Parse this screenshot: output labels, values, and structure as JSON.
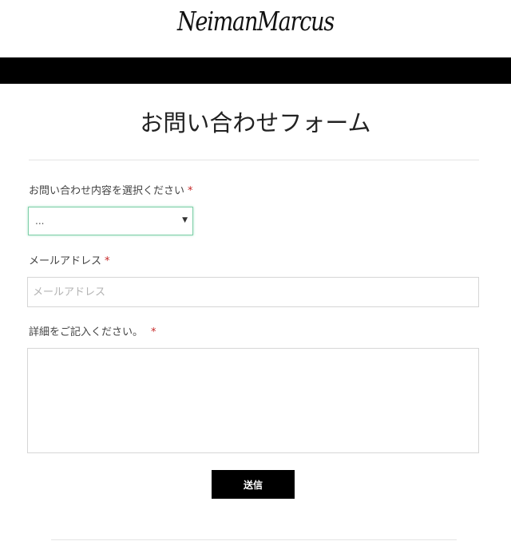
{
  "brand": {
    "logo_text": "NeimanMarcus"
  },
  "form": {
    "title": "お問い合わせフォーム",
    "inquiry_type": {
      "label": "お問い合わせ内容を選択ください",
      "required_mark": "*",
      "selected_value": "...",
      "arrow": "▼"
    },
    "email": {
      "label": "メールアドレス",
      "required_mark": "*",
      "placeholder": "メールアドレス",
      "value": ""
    },
    "details": {
      "label": "詳細をご記入ください。",
      "required_mark": "*",
      "value": ""
    },
    "submit_label": "送信"
  },
  "colors": {
    "nav_bar": "#000000",
    "submit_bg": "#000000",
    "required": "#c62828",
    "focus_border": "#7ecfa8"
  }
}
